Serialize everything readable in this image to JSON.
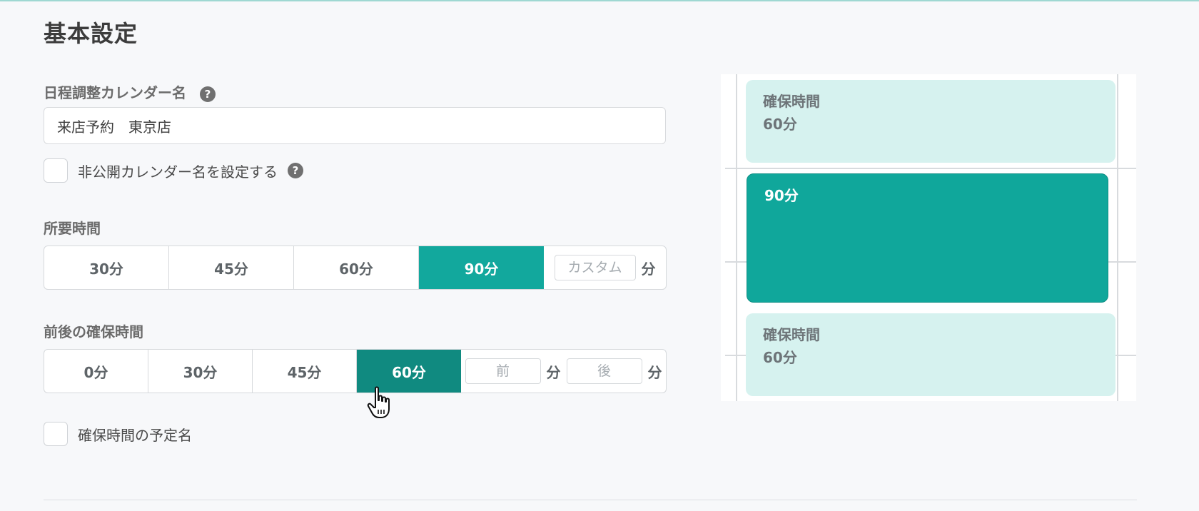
{
  "section": {
    "title": "基本設定"
  },
  "calendar_name": {
    "label": "日程調整カレンダー名",
    "help": "?",
    "value": "来店予約　東京店"
  },
  "private_name": {
    "label": "非公開カレンダー名を設定する",
    "help": "?"
  },
  "duration": {
    "label": "所要時間",
    "options": [
      "30分",
      "45分",
      "60分",
      "90分"
    ],
    "selected": "90分",
    "custom_placeholder": "カスタム",
    "unit": "分"
  },
  "buffer": {
    "label": "前後の確保時間",
    "options": [
      "0分",
      "30分",
      "45分",
      "60分"
    ],
    "selected": "60分",
    "before_placeholder": "前",
    "after_placeholder": "後",
    "unit": "分"
  },
  "buffer_event_name": {
    "label": "確保時間の予定名"
  },
  "preview": {
    "top_block": {
      "title": "確保時間",
      "value": "60分"
    },
    "main_block": {
      "value": "90分"
    },
    "bottom_block": {
      "title": "確保時間",
      "value": "60分"
    }
  },
  "colors": {
    "accent": "#12a89d",
    "accent_dark": "#108a80",
    "buffer_bg": "#d6f2ef"
  }
}
